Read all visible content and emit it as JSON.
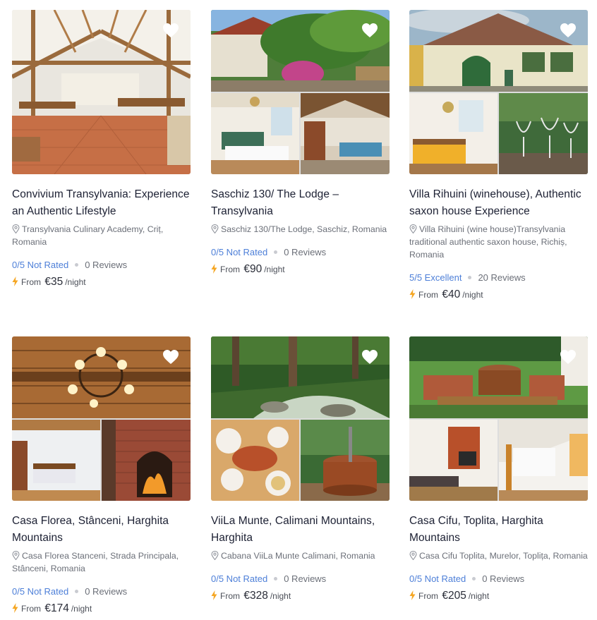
{
  "colors": {
    "rating_link": "#4d7fd8",
    "bolt": "#f5a623",
    "title": "#1c2033",
    "muted": "#6b6f78"
  },
  "icons": {
    "favorite": "heart-icon",
    "location": "map-pin-icon",
    "price": "lightning-bolt-icon"
  },
  "listings": [
    {
      "title": "Convivium Transylvania: Experience an Authentic Lifestyle",
      "address": "Transylvania Culinary Academy, Criț, Romania",
      "rating": "0/5 Not Rated",
      "reviews": "0 Reviews",
      "from_label": "From",
      "price": "€35",
      "per_night": "/night"
    },
    {
      "title": "Saschiz 130/ The Lodge – Transylvania",
      "address": "Saschiz 130/The Lodge, Saschiz, Romania",
      "rating": "0/5 Not Rated",
      "reviews": "0 Reviews",
      "from_label": "From",
      "price": "€90",
      "per_night": "/night"
    },
    {
      "title": "Villa Rihuini (winehouse), Authentic saxon house Experience",
      "address": "Villa Rihuini (wine house)Transylvania traditional authentic saxon house, Richiș, Romania",
      "rating": "5/5 Excellent",
      "reviews": "20 Reviews",
      "from_label": "From",
      "price": "€40",
      "per_night": "/night"
    },
    {
      "title": "Casa Florea, Stânceni, Harghita Mountains",
      "address": "Casa Florea Stanceni, Strada Principala, Stânceni, Romania",
      "rating": "0/5 Not Rated",
      "reviews": "0 Reviews",
      "from_label": "From",
      "price": "€174",
      "per_night": "/night"
    },
    {
      "title": "ViiLa Munte, Calimani Mountains, Harghita",
      "address": "Cabana ViiLa Munte Calimani, Romania",
      "rating": "0/5 Not Rated",
      "reviews": "0 Reviews",
      "from_label": "From",
      "price": "€328",
      "per_night": "/night"
    },
    {
      "title": "Casa Cifu, Toplita, Harghita Mountains",
      "address": "Casa Cifu Toplita, Murelor, Toplița, Romania",
      "rating": "0/5 Not Rated",
      "reviews": "0 Reviews",
      "from_label": "From",
      "price": "€205",
      "per_night": "/night"
    }
  ]
}
